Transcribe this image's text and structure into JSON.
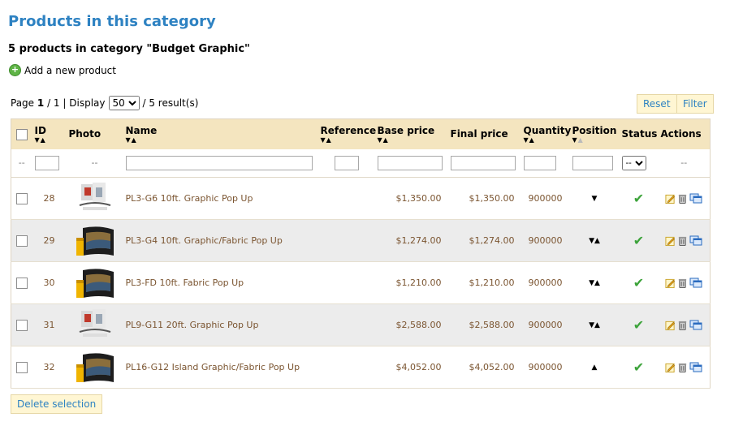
{
  "page_title": "Products in this category",
  "count_line": "5 products in category \"Budget Graphic\"",
  "add_product": "Add a new product",
  "pager": {
    "page_label": "Page",
    "page_current": "1",
    "page_total": "/ 1",
    "display_label": "| Display",
    "display_value": "50",
    "results": "/ 5 result(s)"
  },
  "buttons": {
    "reset": "Reset",
    "filter": "Filter",
    "delete_selection": "Delete selection"
  },
  "columns": {
    "id": "ID",
    "photo": "Photo",
    "name": "Name",
    "reference": "Reference",
    "base_price": "Base price",
    "final_price": "Final price",
    "quantity": "Quantity",
    "position": "Position",
    "status": "Status",
    "actions": "Actions"
  },
  "filter_row": {
    "dash": "--",
    "status_select": "--"
  },
  "rows": [
    {
      "id": "28",
      "name": "PL3-G6 10ft. Graphic Pop Up",
      "base_price": "$1,350.00",
      "final_price": "$1,350.00",
      "quantity": "900000",
      "position": "down",
      "photo": "white-graphic"
    },
    {
      "id": "29",
      "name": "PL3-G4 10ft. Graphic/Fabric Pop Up",
      "base_price": "$1,274.00",
      "final_price": "$1,274.00",
      "quantity": "900000",
      "position": "both",
      "photo": "dark-display"
    },
    {
      "id": "30",
      "name": "PL3-FD 10ft. Fabric Pop Up",
      "base_price": "$1,210.00",
      "final_price": "$1,210.00",
      "quantity": "900000",
      "position": "both",
      "photo": "dark-display"
    },
    {
      "id": "31",
      "name": "PL9-G11 20ft. Graphic Pop Up",
      "base_price": "$2,588.00",
      "final_price": "$2,588.00",
      "quantity": "900000",
      "position": "both",
      "photo": "white-graphic"
    },
    {
      "id": "32",
      "name": "PL16-G12 Island Graphic/Fabric Pop Up",
      "base_price": "$4,052.00",
      "final_price": "$4,052.00",
      "quantity": "900000",
      "position": "up",
      "photo": "dark-display"
    }
  ],
  "icons": {
    "add": "plus-circle-icon",
    "status": "check-icon",
    "edit": "pencil-icon",
    "delete": "trash-icon",
    "duplicate": "duplicate-icon"
  },
  "colors": {
    "title": "#2e82c2",
    "link": "#7b5531",
    "header_bg": "#f4e5bf",
    "alt_row": "#ececec",
    "button_bg": "#fff6d3"
  }
}
